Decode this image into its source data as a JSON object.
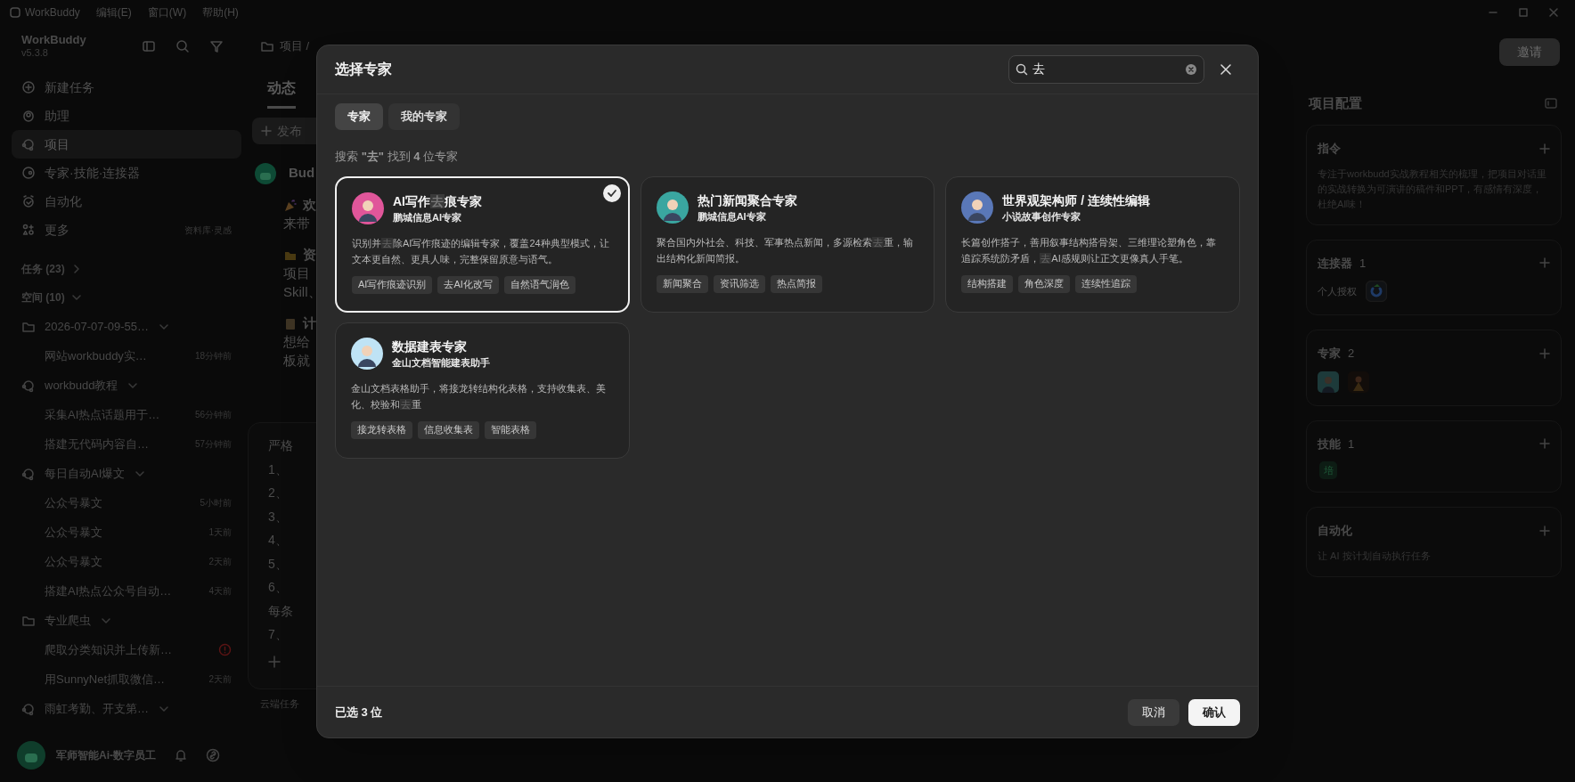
{
  "title_bar": {
    "menus": [
      "WorkBuddy",
      "编辑(E)",
      "窗口(W)",
      "帮助(H)"
    ]
  },
  "sidebar": {
    "app_name": "WorkBuddy",
    "version": "v5.3.8",
    "nav": [
      {
        "label": "新建任务",
        "selected": false
      },
      {
        "label": "助理",
        "selected": false
      },
      {
        "label": "项目",
        "selected": true
      },
      {
        "label": "专家·技能·连接器",
        "selected": false
      },
      {
        "label": "自动化",
        "selected": false
      },
      {
        "label": "更多",
        "hint": "资料库·灵感",
        "selected": false
      }
    ],
    "sections": [
      {
        "label": "任务 (23)",
        "expanded": false
      },
      {
        "label": "空间 (10)",
        "expanded": true
      }
    ],
    "tree": [
      {
        "kind": "folder",
        "label": "2026-07-07-09-55…",
        "expanded": true,
        "children": [
          {
            "label": "网站workbuddy实…",
            "time": "18分钟前",
            "alert": false
          }
        ]
      },
      {
        "kind": "project",
        "label": "workbudd教程",
        "expanded": true,
        "children": [
          {
            "label": "采集AI热点话题用于…",
            "time": "56分钟前",
            "alert": false
          },
          {
            "label": "搭建无代码内容自…",
            "time": "57分钟前",
            "alert": false
          }
        ]
      },
      {
        "kind": "project",
        "label": "每日自动AI爆文",
        "expanded": true,
        "children": [
          {
            "label": "公众号暴文",
            "time": "5小时前",
            "alert": false
          },
          {
            "label": "公众号暴文",
            "time": "1天前",
            "alert": false
          },
          {
            "label": "公众号暴文",
            "time": "2天前",
            "alert": false
          },
          {
            "label": "搭建AI热点公众号自动…",
            "time": "4天前",
            "alert": false
          }
        ]
      },
      {
        "kind": "folder",
        "label": "专业爬虫",
        "expanded": true,
        "children": [
          {
            "label": "爬取分类知识并上传新…",
            "alert": true
          },
          {
            "label": "用SunnyNet抓取微信…",
            "time": "2天前",
            "alert": false
          }
        ]
      },
      {
        "kind": "project",
        "label": "雨虹考勤、开支第…",
        "expanded": true
      }
    ],
    "user": {
      "name": "军师智能Ai-数字员工"
    }
  },
  "main": {
    "breadcrumb": "项目 /",
    "tabs": [
      {
        "label": "动态",
        "selected": true
      }
    ],
    "post_button": "发布",
    "feed": [
      {
        "kind": "author",
        "text": "Bud"
      },
      {
        "kind": "party",
        "text": "欢"
      },
      {
        "kind": "text",
        "text": "来带"
      },
      {
        "kind": "folder",
        "text": "资"
      },
      {
        "kind": "text",
        "text": "项目"
      },
      {
        "kind": "text",
        "text": "Skill、"
      },
      {
        "kind": "doc",
        "text": "计"
      },
      {
        "kind": "text",
        "text": "想给"
      },
      {
        "kind": "text",
        "text": "板就"
      }
    ],
    "prompt": {
      "lines": [
        "严格",
        "1、",
        "2、",
        "3、",
        "4、",
        "5、",
        "6、",
        "每条",
        "7、"
      ]
    },
    "cloud_button": "云端任务"
  },
  "right_panel": {
    "invite_button": "邀请",
    "title": "项目配置",
    "sections": [
      {
        "kind": "text",
        "title": "指令",
        "text": "专注于workbudd实战教程相关的梳理，把项目对话里的实战转换为可演讲的稿件和PPT，有感情有深度，杜绝AI味！"
      },
      {
        "kind": "connector",
        "title": "连接器",
        "count": "1",
        "text": "个人授权"
      },
      {
        "kind": "avatars",
        "title": "专家",
        "count": "2"
      },
      {
        "kind": "skill",
        "title": "技能",
        "count": "1",
        "badge": "培"
      },
      {
        "kind": "text",
        "title": "自动化",
        "text": "让 AI 按计划自动执行任务"
      }
    ]
  },
  "modal": {
    "title": "选择专家",
    "search": {
      "value": "去"
    },
    "tabs": [
      {
        "label": "专家",
        "selected": true
      },
      {
        "label": "我的专家",
        "selected": false
      }
    ],
    "result": "搜索 **\"去\"** 找到 **4** 位专家",
    "experts": [
      {
        "title": [
          "AI写作",
          "去",
          "痕专家"
        ],
        "subtitle": "鹏城信息AI专家",
        "description": [
          "识别并",
          "去",
          "除AI写作痕迹的编辑专家，覆盖24种典型模式，让文本更自然、更具人味，完整保留原意与语气。"
        ],
        "tags": [
          "AI写作痕迹识别",
          "去AI化改写",
          "自然语气润色"
        ],
        "selected": true,
        "color": "#e0569a"
      },
      {
        "title": [
          "热门新闻聚合专家"
        ],
        "subtitle": "鹏城信息AI专家",
        "description": [
          "聚合国内外社会、科技、军事热点新闻，多源检索",
          "去",
          "重，输出结构化新闻简报。"
        ],
        "tags": [
          "新闻聚合",
          "资讯筛选",
          "热点简报"
        ],
        "selected": false,
        "color": "#3aa6a0"
      },
      {
        "title": [
          "世界观架构师 / 连续性编辑"
        ],
        "subtitle": "小说故事创作专家",
        "description": [
          "长篇创作搭子，善用叙事结构搭骨架、三维理论塑角色，靠追踪系统防矛盾，",
          "去",
          "AI感规则让正文更像真人手笔。"
        ],
        "tags": [
          "结构搭建",
          "角色深度",
          "连续性追踪"
        ],
        "selected": false,
        "color": "#5a78b8"
      },
      {
        "title": [
          "数据建表专家"
        ],
        "subtitle": "金山文档智能建表助手",
        "description": [
          "金山文档表格助手，将接龙转结构化表格，支持收集表、美化、校验和",
          "去",
          "重"
        ],
        "tags": [
          "接龙转表格",
          "信息收集表",
          "智能表格"
        ],
        "selected": false,
        "color": "#bfe3f5"
      }
    ],
    "footer": {
      "selected_text": "已选 3 位",
      "cancel": "取消",
      "confirm": "确认"
    }
  }
}
